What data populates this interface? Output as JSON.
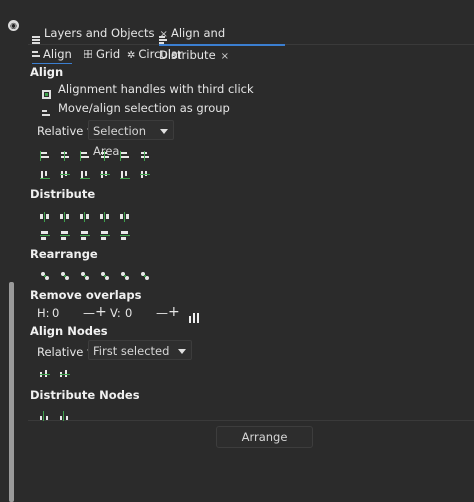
{
  "tabs": [
    {
      "label": "Layers and Objects",
      "close": "×"
    },
    {
      "label": "Align and Distribute",
      "close": "×"
    }
  ],
  "subtabs": [
    "Align",
    "Grid",
    "Circular"
  ],
  "align": {
    "title": "Align",
    "option1": "Alignment handles with third click",
    "option2": "Move/align selection as group",
    "relative_label": "Relative to:",
    "relative_value": "Selection Area"
  },
  "distribute": {
    "title": "Distribute"
  },
  "rearrange": {
    "title": "Rearrange"
  },
  "remove_overlaps": {
    "title": "Remove overlaps",
    "h_label": "H:",
    "h_value": "0",
    "v_label": "V:",
    "v_value": "0",
    "minus": "—",
    "plus": "+"
  },
  "align_nodes": {
    "title": "Align Nodes",
    "relative_label": "Relative to:",
    "relative_value": "First selected"
  },
  "distribute_nodes": {
    "title": "Distribute Nodes"
  },
  "arrange_button": "Arrange",
  "colors": {
    "accent": "#3b7fd1",
    "icon_green": "#3fa34d",
    "bg": "#2b2b2b"
  }
}
